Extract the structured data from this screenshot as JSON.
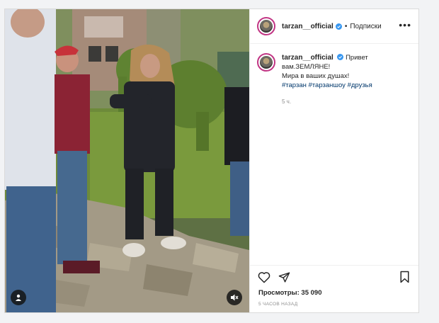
{
  "post": {
    "username": "tarzan__official",
    "follow_label": "Подписки",
    "dot": "•",
    "more_label": "•••"
  },
  "caption": {
    "username": "tarzan__official",
    "text_line1": "Привет",
    "text_line2": "вам.ЗЕМЛЯНЕ!",
    "text_line3": "Мира в ваших душах!",
    "hashtags": "#тарзан #тарзаншоу #друзья",
    "time_ago": "5 ч."
  },
  "stats": {
    "views": "Просмотры: 35 090",
    "date": "5 ЧАСОВ НАЗАД"
  },
  "icons": {
    "verified": "verified-badge-icon",
    "like": "heart-icon",
    "share": "paper-plane-icon",
    "save": "bookmark-icon",
    "user": "user-tag-icon",
    "mute": "muted-speaker-icon"
  },
  "colors": {
    "verified": "#3897f0",
    "link": "#00376b",
    "muted_text": "#8e8e8e",
    "story_ring": "#c13584"
  }
}
